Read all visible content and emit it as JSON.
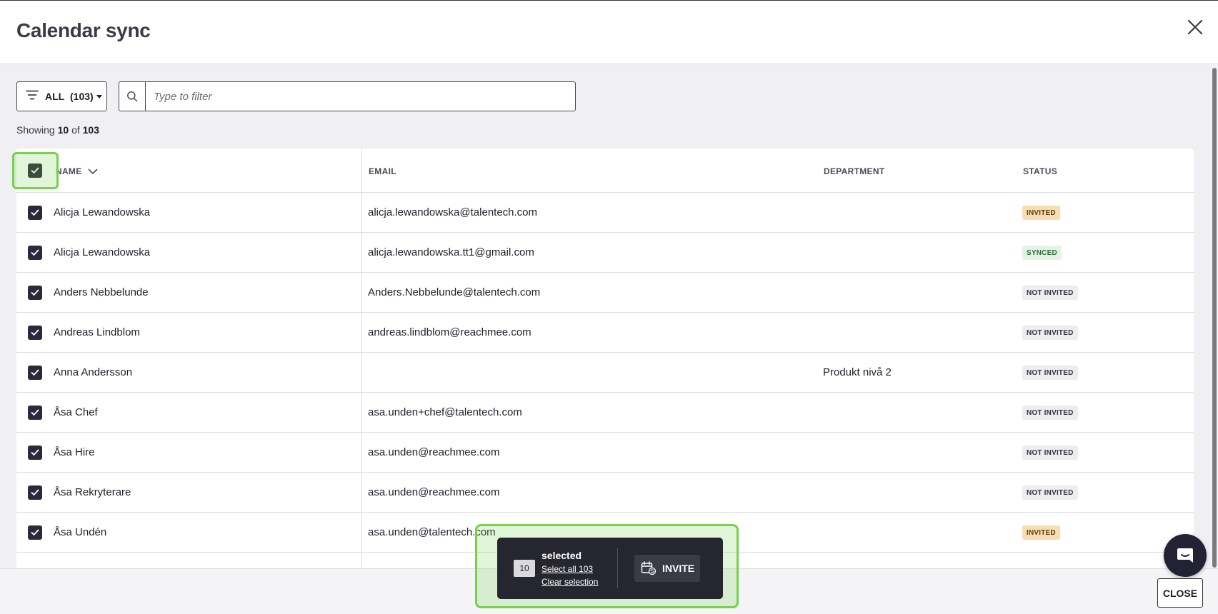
{
  "header": {
    "title": "Calendar sync"
  },
  "toolbar": {
    "filter_label": "ALL",
    "filter_count": "(103)",
    "search_placeholder": "Type to filter"
  },
  "summary": {
    "prefix": "Showing",
    "shown": "10",
    "of": "of",
    "total": "103"
  },
  "table": {
    "columns": {
      "name": "NAME",
      "email": "EMAIL",
      "department": "DEPARTMENT",
      "status": "STATUS"
    },
    "rows": [
      {
        "name": "Alicja Lewandowska",
        "email": "alicja.lewandowska@talentech.com",
        "department": "",
        "status": "INVITED",
        "checked": true
      },
      {
        "name": "Alicja Lewandowska",
        "email": "alicja.lewandowska.tt1@gmail.com",
        "department": "",
        "status": "SYNCED",
        "checked": true
      },
      {
        "name": "Anders Nebbelunde",
        "email": "Anders.Nebbelunde@talentech.com",
        "department": "",
        "status": "NOT INVITED",
        "checked": true
      },
      {
        "name": "Andreas Lindblom",
        "email": "andreas.lindblom@reachmee.com",
        "department": "",
        "status": "NOT INVITED",
        "checked": true
      },
      {
        "name": "Anna Andersson",
        "email": "",
        "department": "Produkt nivå 2",
        "status": "NOT INVITED",
        "checked": true
      },
      {
        "name": "Åsa Chef",
        "email": "asa.unden+chef@talentech.com",
        "department": "",
        "status": "NOT INVITED",
        "checked": true
      },
      {
        "name": "Åsa Hire",
        "email": "asa.unden@reachmee.com",
        "department": "",
        "status": "NOT INVITED",
        "checked": true
      },
      {
        "name": "Åsa Rekryterare",
        "email": "asa.unden@reachmee.com",
        "department": "",
        "status": "NOT INVITED",
        "checked": true
      },
      {
        "name": "Åsa Undén",
        "email": "asa.unden@talentech.com",
        "department": "",
        "status": "INVITED",
        "checked": true
      }
    ]
  },
  "selection": {
    "count": "10",
    "label": "selected",
    "select_all": "Select all 103",
    "clear": "Clear selection",
    "invite_label": "INVITE"
  },
  "footer": {
    "close_label": "CLOSE"
  },
  "colors": {
    "checkbox": "#2a2a3c",
    "highlight": "#78d04e",
    "invited": "#f8ddb0",
    "synced": "#e3f3e6",
    "not_invited": "#ececf1"
  }
}
